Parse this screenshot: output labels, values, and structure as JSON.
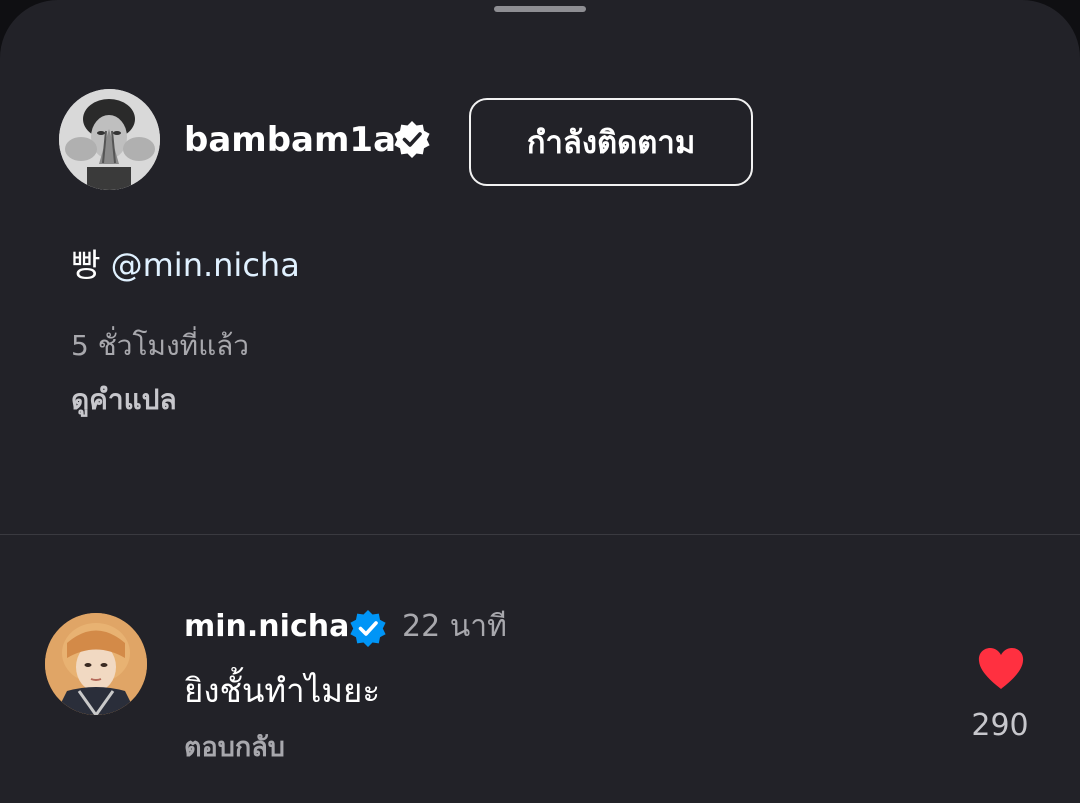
{
  "post": {
    "owner": {
      "username": "bambam1a",
      "verified": true,
      "follow_button_label": "กำลังติดตาม"
    },
    "caption": {
      "text": "빵 ",
      "mention": "@min.nicha"
    },
    "time_ago": "5 ชั่วโมงที่แล้ว",
    "see_translation_label": "ดูคำแปล"
  },
  "comment": {
    "username": "min.nicha",
    "verified": true,
    "time_ago": "22 นาที",
    "text": "ยิงชั้นทำไมยะ",
    "reply_label": "ตอบกลับ",
    "like_count": "290",
    "liked": true
  },
  "icons": {
    "verified_badge_owner": "verified-badge-white",
    "verified_badge_commenter": "verified-badge-blue",
    "like": "heart-filled"
  },
  "colors": {
    "sheet_background": "#222228",
    "verified_blue": "#0095f6",
    "like_red": "#ff3040",
    "muted_text": "#a8a8ad"
  }
}
